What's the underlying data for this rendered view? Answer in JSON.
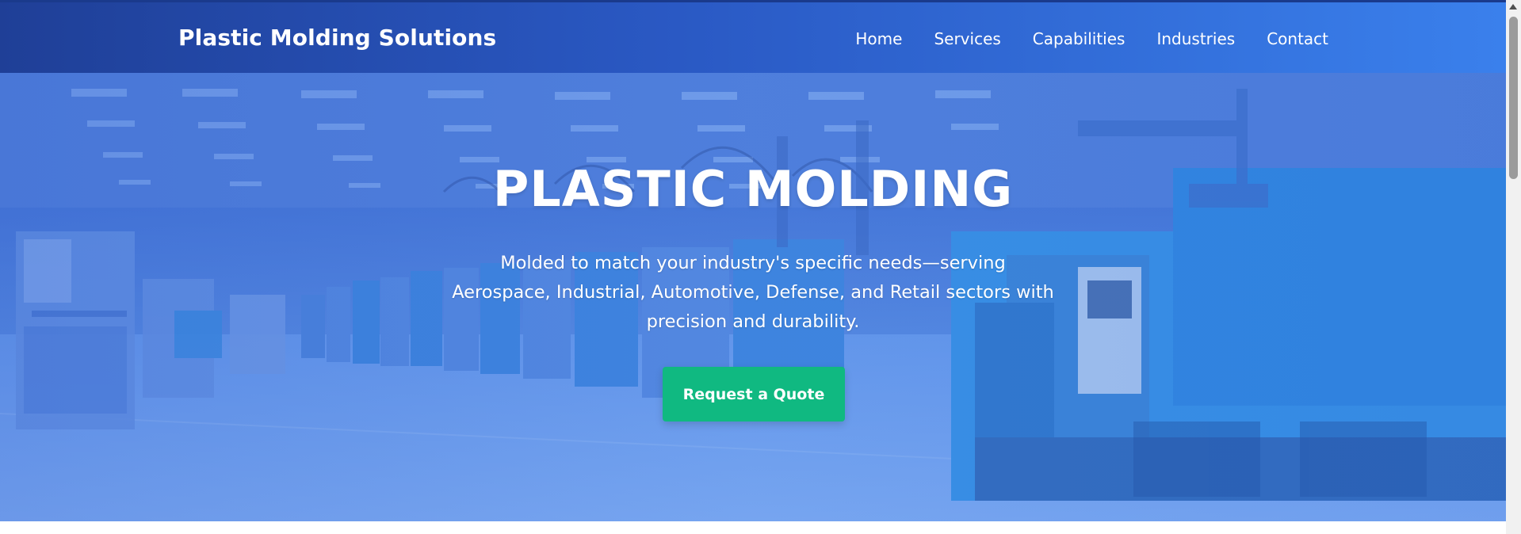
{
  "header": {
    "logo": "Plastic Molding Solutions",
    "nav": [
      "Home",
      "Services",
      "Capabilities",
      "Industries",
      "Contact"
    ]
  },
  "hero": {
    "title": "PLASTIC MOLDING",
    "subtitle": "Molded to match your industry's specific needs—serving Aerospace, Industrial, Automotive, Defense, and Retail sectors with precision and durability.",
    "cta_label": "Request a Quote"
  },
  "colors": {
    "header_start": "#1f3f97",
    "header_end": "#3a80ec",
    "hero_tint": "#4a86e6",
    "cta": "#10b981",
    "text": "#ffffff"
  },
  "icons": [
    "scroll-up-arrow"
  ]
}
